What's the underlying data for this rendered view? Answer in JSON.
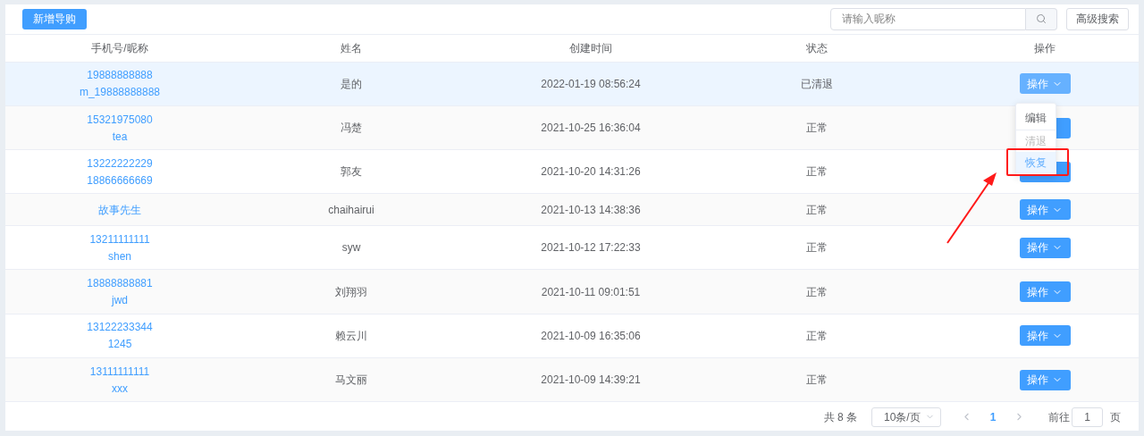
{
  "toolbar": {
    "add_button": "新增导购",
    "search": {
      "placeholder": "请输入昵称"
    },
    "advanced_button": "高级搜索"
  },
  "table": {
    "columns": [
      "手机号/昵称",
      "姓名",
      "创建时间",
      "状态",
      "操作"
    ],
    "rows": [
      {
        "lines": [
          "19888888888",
          "m_19888888888"
        ],
        "name": "是的",
        "created": "2022-01-19 08:56:24",
        "status": "已清退",
        "action": "操作",
        "hovered": true
      },
      {
        "lines": [
          "15321975080",
          "tea"
        ],
        "name": "冯楚",
        "created": "2021-10-25 16:36:04",
        "status": "正常",
        "hovered": false
      },
      {
        "lines": [
          "13222222229",
          "18866666669"
        ],
        "name": "郭友",
        "created": "2021-10-20 14:31:26",
        "status": "正常",
        "hovered": false
      },
      {
        "lines": [
          "故事先生"
        ],
        "name": "chaihairui",
        "created": "2021-10-13 14:38:36",
        "status": "正常",
        "action": "操作",
        "hovered": false
      },
      {
        "lines": [
          "13211111111",
          "shen"
        ],
        "name": "syw",
        "created": "2021-10-12 17:22:33",
        "status": "正常",
        "action": "操作",
        "hovered": false
      },
      {
        "lines": [
          "18888888881",
          "jwd"
        ],
        "name": "刘翔羽",
        "created": "2021-10-11 09:01:51",
        "status": "正常",
        "action": "操作",
        "hovered": false
      },
      {
        "lines": [
          "13122233344",
          "1245"
        ],
        "name": "赖云川",
        "created": "2021-10-09 16:35:06",
        "status": "正常",
        "action": "操作",
        "hovered": false
      },
      {
        "lines": [
          "13111111111",
          "xxx"
        ],
        "name": "马文丽",
        "created": "2021-10-09 14:39:21",
        "status": "正常",
        "action": "操作",
        "hovered": false
      }
    ]
  },
  "action_menu": {
    "items": [
      {
        "label": "编辑",
        "disabled": false,
        "highlighted": false
      },
      {
        "label": "清退",
        "disabled": true,
        "highlighted": false
      },
      {
        "label": "恢复",
        "disabled": false,
        "highlighted": true
      }
    ]
  },
  "pagination": {
    "total": "共 8 条",
    "page_size": "10条/页",
    "pages": [
      {
        "label": "1",
        "selected": true
      }
    ],
    "goto_label": "前往",
    "goto_value": "1",
    "page_suffix": "页"
  }
}
